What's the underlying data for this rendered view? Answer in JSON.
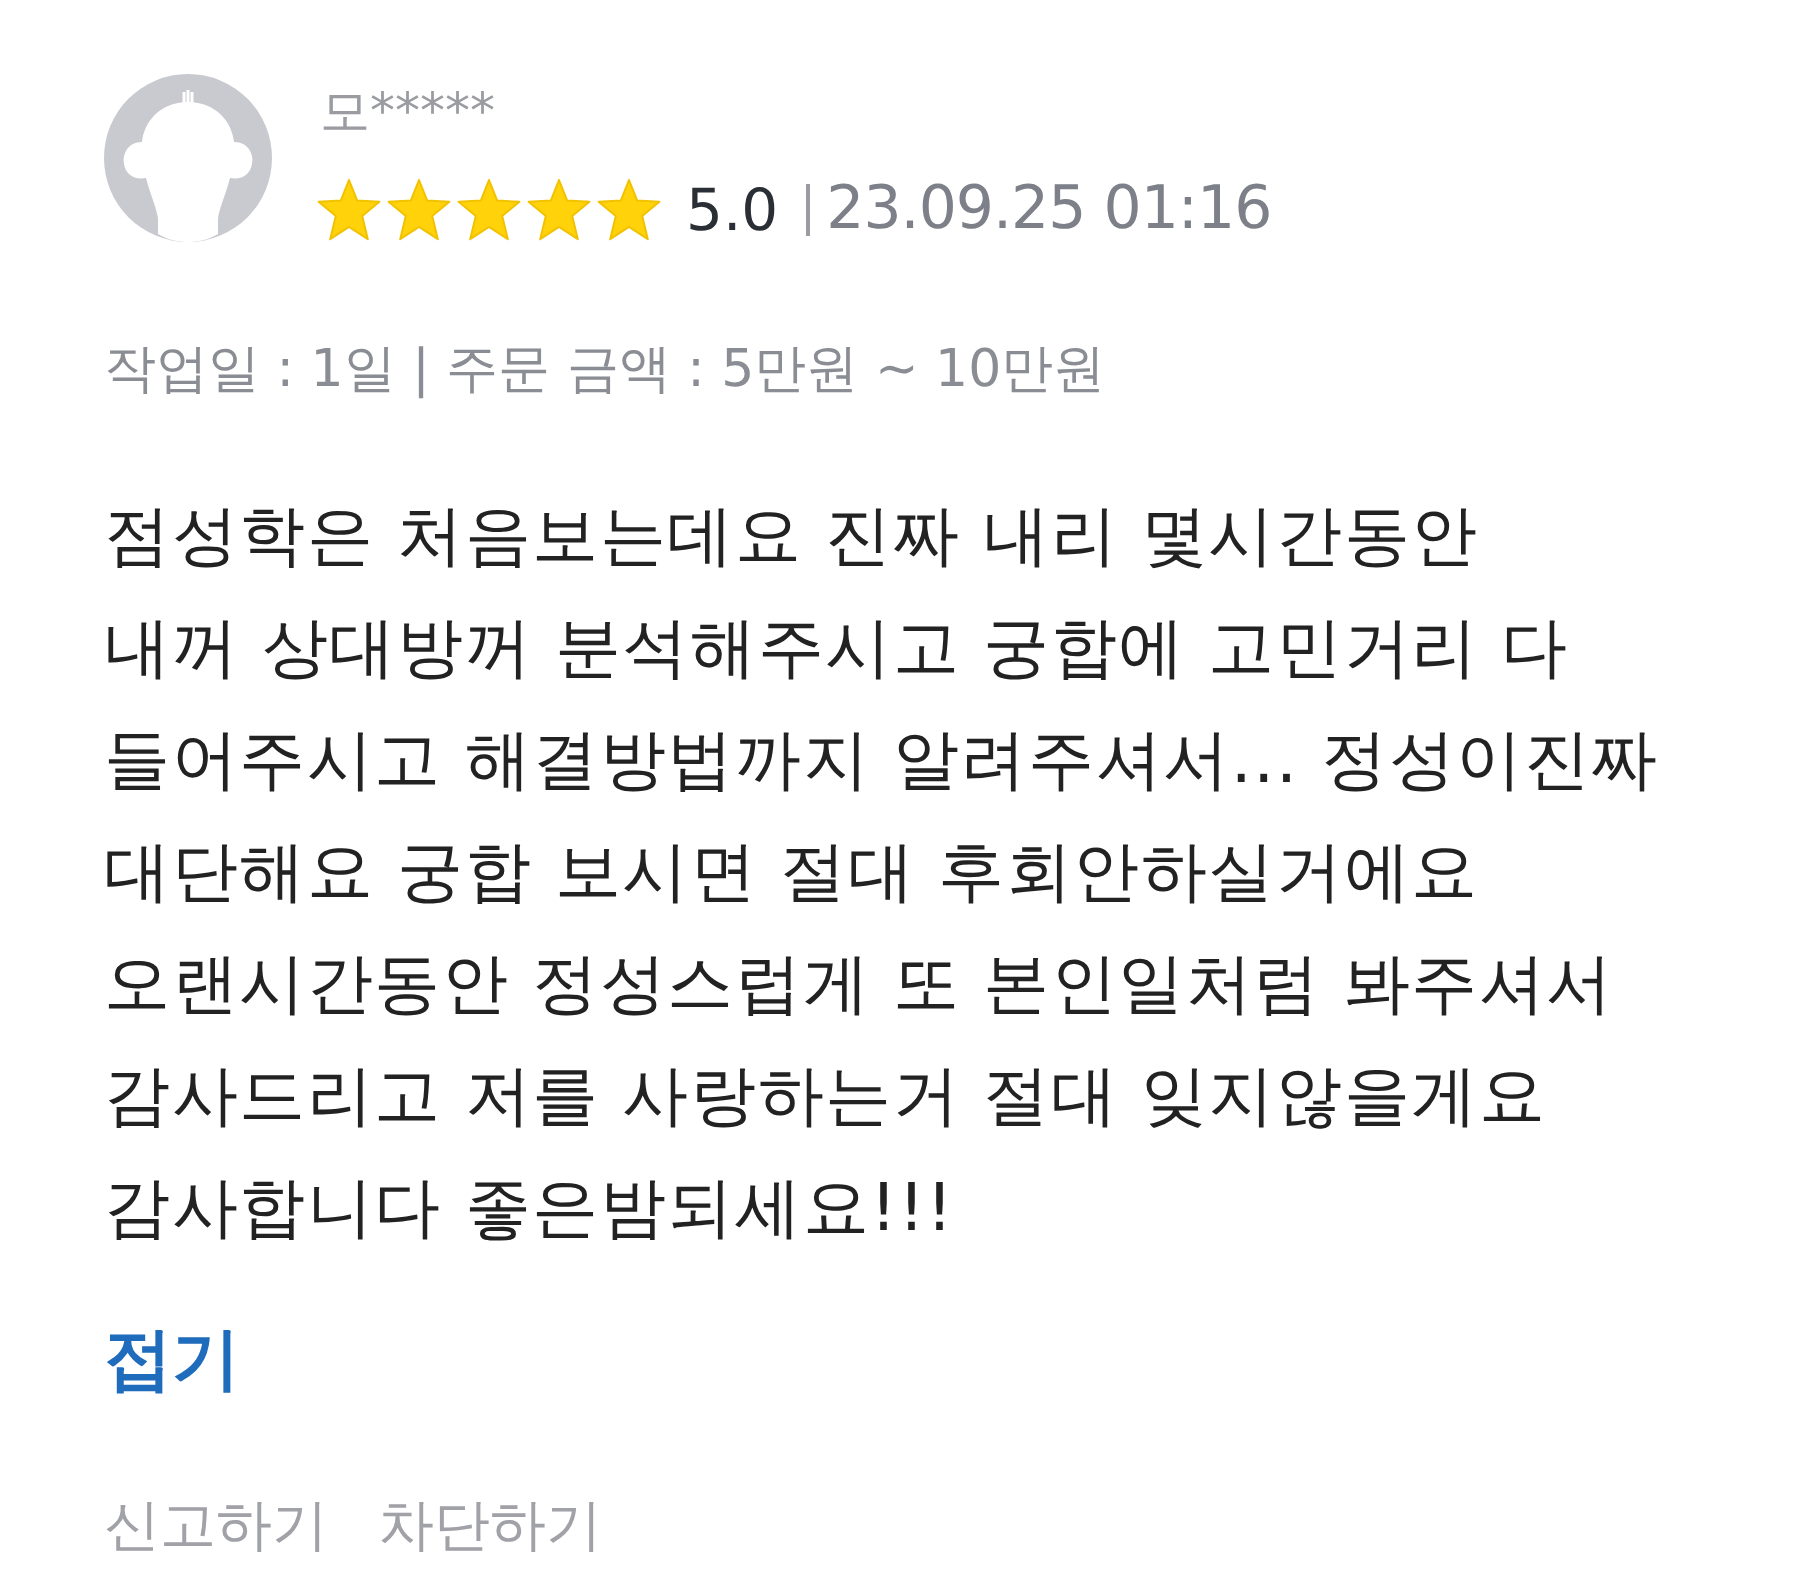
{
  "review": {
    "author": "모*****",
    "stars": 5,
    "rating": "5.0",
    "date": "23.09.25 01:16",
    "meta": "작업일 : 1일 | 주문 금액 : 5만원 ~ 10만원",
    "body": "점성학은 처음보는데요 진짜 내리 몇시간동안\n내꺼 상대방꺼 분석해주시고 궁합에 고민거리 다\n들어주시고 해결방법까지 알려주셔서... 정성이진짜\n대단해요 궁합 보시면 절대 후회안하실거에요\n오랜시간동안 정성스럽게 또 본인일처럼 봐주셔서\n감사드리고 저를 사랑하는거 절대 잊지않을게요\n감사합니다 좋은밤되세요!!!",
    "collapse_link": "접기"
  },
  "actions": [
    "신고하기",
    "차단하기"
  ]
}
